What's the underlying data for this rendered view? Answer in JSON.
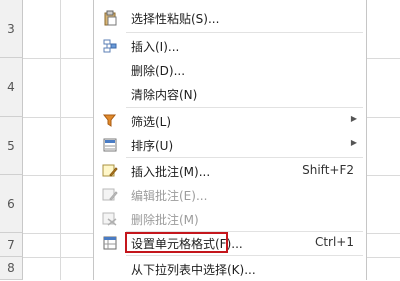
{
  "row_headers": [
    "3",
    "4",
    "5",
    "6",
    "7",
    "8"
  ],
  "menu": {
    "items": [
      {
        "label": "选择性粘贴(S)...",
        "icon": "paste-icon"
      },
      {
        "label": "插入(I)...",
        "icon": "insert-icon"
      },
      {
        "label": "删除(D)...",
        "icon": ""
      },
      {
        "label": "清除内容(N)",
        "icon": ""
      },
      {
        "label": "筛选(L)",
        "icon": "filter-icon"
      },
      {
        "label": "排序(U)",
        "icon": "sort-icon"
      },
      {
        "label": "插入批注(M)...",
        "icon": "insert-comment-icon",
        "shortcut": "Shift+F2"
      },
      {
        "label": "编辑批注(E)...",
        "icon": "edit-comment-icon"
      },
      {
        "label": "删除批注(M)",
        "icon": "delete-comment-icon"
      },
      {
        "label": "设置单元格格式(F)...",
        "icon": "format-cells-icon",
        "shortcut": "Ctrl+1"
      },
      {
        "label": "从下拉列表中选择(K)...",
        "icon": ""
      }
    ],
    "highlight_color": "#c4161c"
  }
}
